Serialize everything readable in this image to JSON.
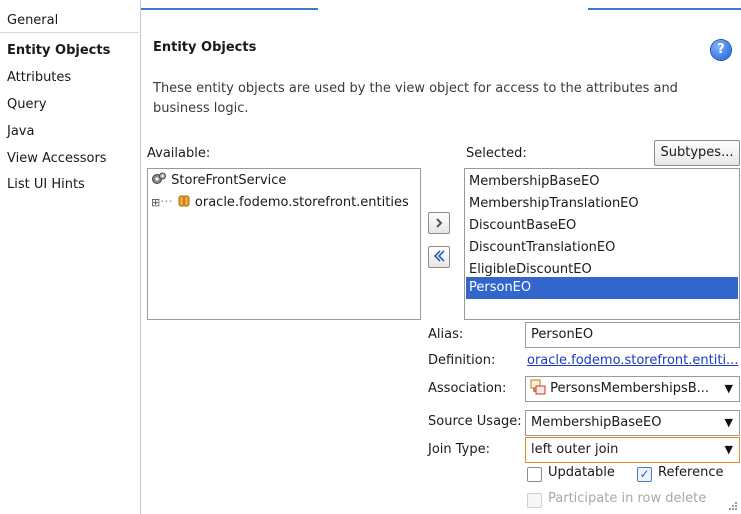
{
  "sidebar": {
    "items": [
      {
        "label": "General"
      },
      {
        "label": "Entity Objects"
      },
      {
        "label": "Attributes"
      },
      {
        "label": "Query"
      },
      {
        "label": "Java"
      },
      {
        "label": "View Accessors"
      },
      {
        "label": "List UI Hints"
      }
    ],
    "selected": "Entity Objects"
  },
  "main": {
    "title": "Entity Objects",
    "help_icon": "help-icon",
    "description": "These entity objects are used by the view object for access to the attributes and business logic."
  },
  "available": {
    "label": "Available:",
    "tree": [
      {
        "label": "StoreFrontService",
        "icon": "service-icon"
      },
      {
        "label": "oracle.fodemo.storefront.entities",
        "icon": "package-icon",
        "expander": "⊞"
      }
    ]
  },
  "shuttle": {
    "add_icon": "shuttle-right-icon",
    "remove_icon": "shuttle-left-icon"
  },
  "selected": {
    "label": "Selected:",
    "subtypes_button": "Subtypes...",
    "items": [
      "MembershipBaseEO",
      "MembershipTranslationEO",
      "DiscountBaseEO",
      "DiscountTranslationEO",
      "EligibleDiscountEO",
      "PersonEO"
    ],
    "active_item": "PersonEO"
  },
  "details": {
    "alias_label": "Alias:",
    "alias_value": "PersonEO",
    "definition_label": "Definition:",
    "definition_value": "oracle.fodemo.storefront.entiti...",
    "association_label": "Association:",
    "association_value": "PersonsMembershipsB...",
    "source_usage_label": "Source Usage:",
    "source_usage_value": "MembershipBaseEO",
    "join_type_label": "Join Type:",
    "join_type_value": "left outer join",
    "updatable_label": "Updatable",
    "updatable_checked": false,
    "reference_label": "Reference",
    "reference_checked": true,
    "participate_label": "Participate in row delete",
    "participate_enabled": false
  }
}
